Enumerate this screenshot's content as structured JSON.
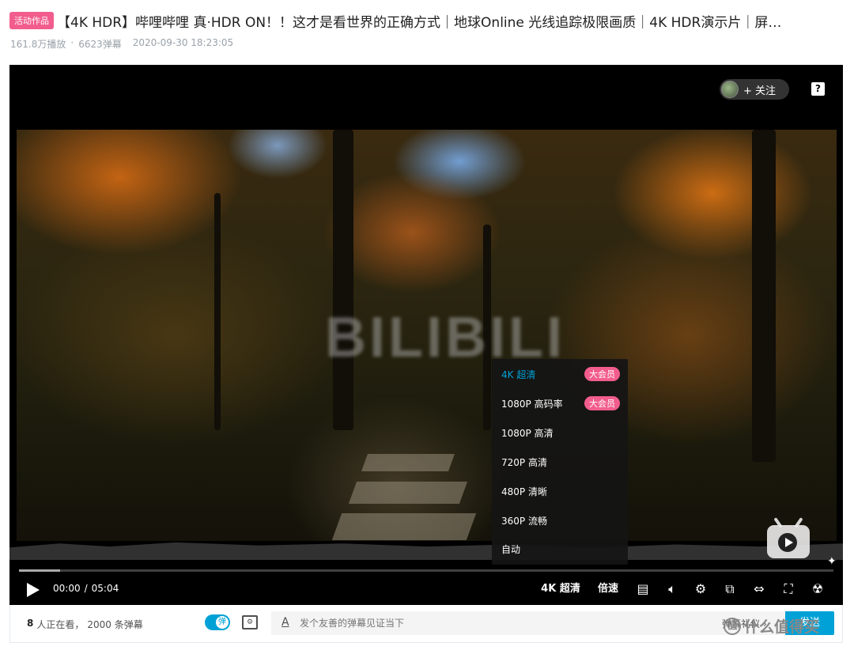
{
  "header": {
    "badge": "活动作品",
    "title": "【4K HDR】哔哩哔哩 真·HDR ON！！这才是看世界的正确方式｜地球Online 光线追踪极限画质｜4K HDR演示片｜屏…",
    "plays": "161.8万播放",
    "separator": "·",
    "danmaku_count": "6623弹幕",
    "date": "2020-09-30 18:23:05"
  },
  "player": {
    "follow_label": "+ 关注",
    "help_label": "?",
    "watermark": "BILIBILI",
    "progress_fraction": 0.0,
    "quality_menu": {
      "items": [
        {
          "label": "4K 超清",
          "badge": "大会员",
          "active": true
        },
        {
          "label": "1080P 高码率",
          "badge": "大会员",
          "active": false
        },
        {
          "label": "1080P 高清",
          "badge": "",
          "active": false
        },
        {
          "label": "720P 高清",
          "badge": "",
          "active": false
        },
        {
          "label": "480P 清晰",
          "badge": "",
          "active": false
        },
        {
          "label": "360P 流畅",
          "badge": "",
          "active": false
        },
        {
          "label": "自动",
          "badge": "",
          "active": false
        }
      ]
    },
    "controls": {
      "current_time": "00:00",
      "time_separator": "/",
      "duration": "05:04",
      "quality_label": "4K 超清",
      "speed_label": "倍速",
      "icons": [
        "play-icon",
        "danmaku-off-icon",
        "volume-icon",
        "settings-gear-icon",
        "picture-in-picture-icon",
        "widescreen-icon",
        "fullscreen-icon",
        "radiation-icon"
      ]
    }
  },
  "bottom_bar": {
    "viewer_count": "8",
    "viewer_text": "人正在看，",
    "danmaku_total": "2000 条弹幕",
    "danmaku_toggle_label": "弹",
    "font_label": "A",
    "input_placeholder": "发个友善的弹幕见证当下",
    "etiquette_label": "弹幕礼仪 ›",
    "send_label": "发送"
  },
  "site_watermark": {
    "logo": "值",
    "text": "什么值得买"
  },
  "colors": {
    "accent": "#00a1d6",
    "badge_pink": "#f25d8e"
  }
}
